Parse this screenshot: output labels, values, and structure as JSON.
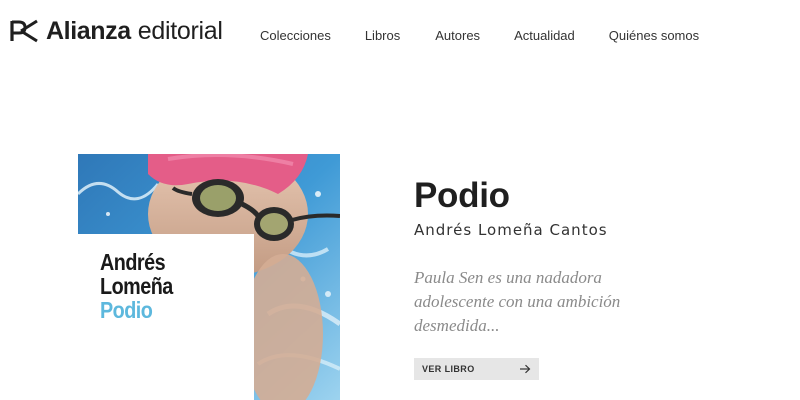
{
  "header": {
    "logo": {
      "name": "Alianza",
      "sub": "editorial",
      "icon": "alianza-logo-mark"
    },
    "nav": [
      {
        "label": "Colecciones"
      },
      {
        "label": "Libros"
      },
      {
        "label": "Autores"
      },
      {
        "label": "Actualidad"
      },
      {
        "label": "Quiénes somos"
      }
    ]
  },
  "book": {
    "cover": {
      "author_line_1": "Andrés",
      "author_line_2": "Lomeña",
      "title": "Podio",
      "title_color": "#5db8dd",
      "image": "swimmer-with-goggles"
    },
    "title": "Podio",
    "author": "Andrés Lomeña Cantos",
    "description": "Paula Sen es una nadadora adolescente con una ambición desmedida...",
    "button": {
      "label": "VER LIBRO",
      "icon": "arrow-right-icon"
    }
  }
}
